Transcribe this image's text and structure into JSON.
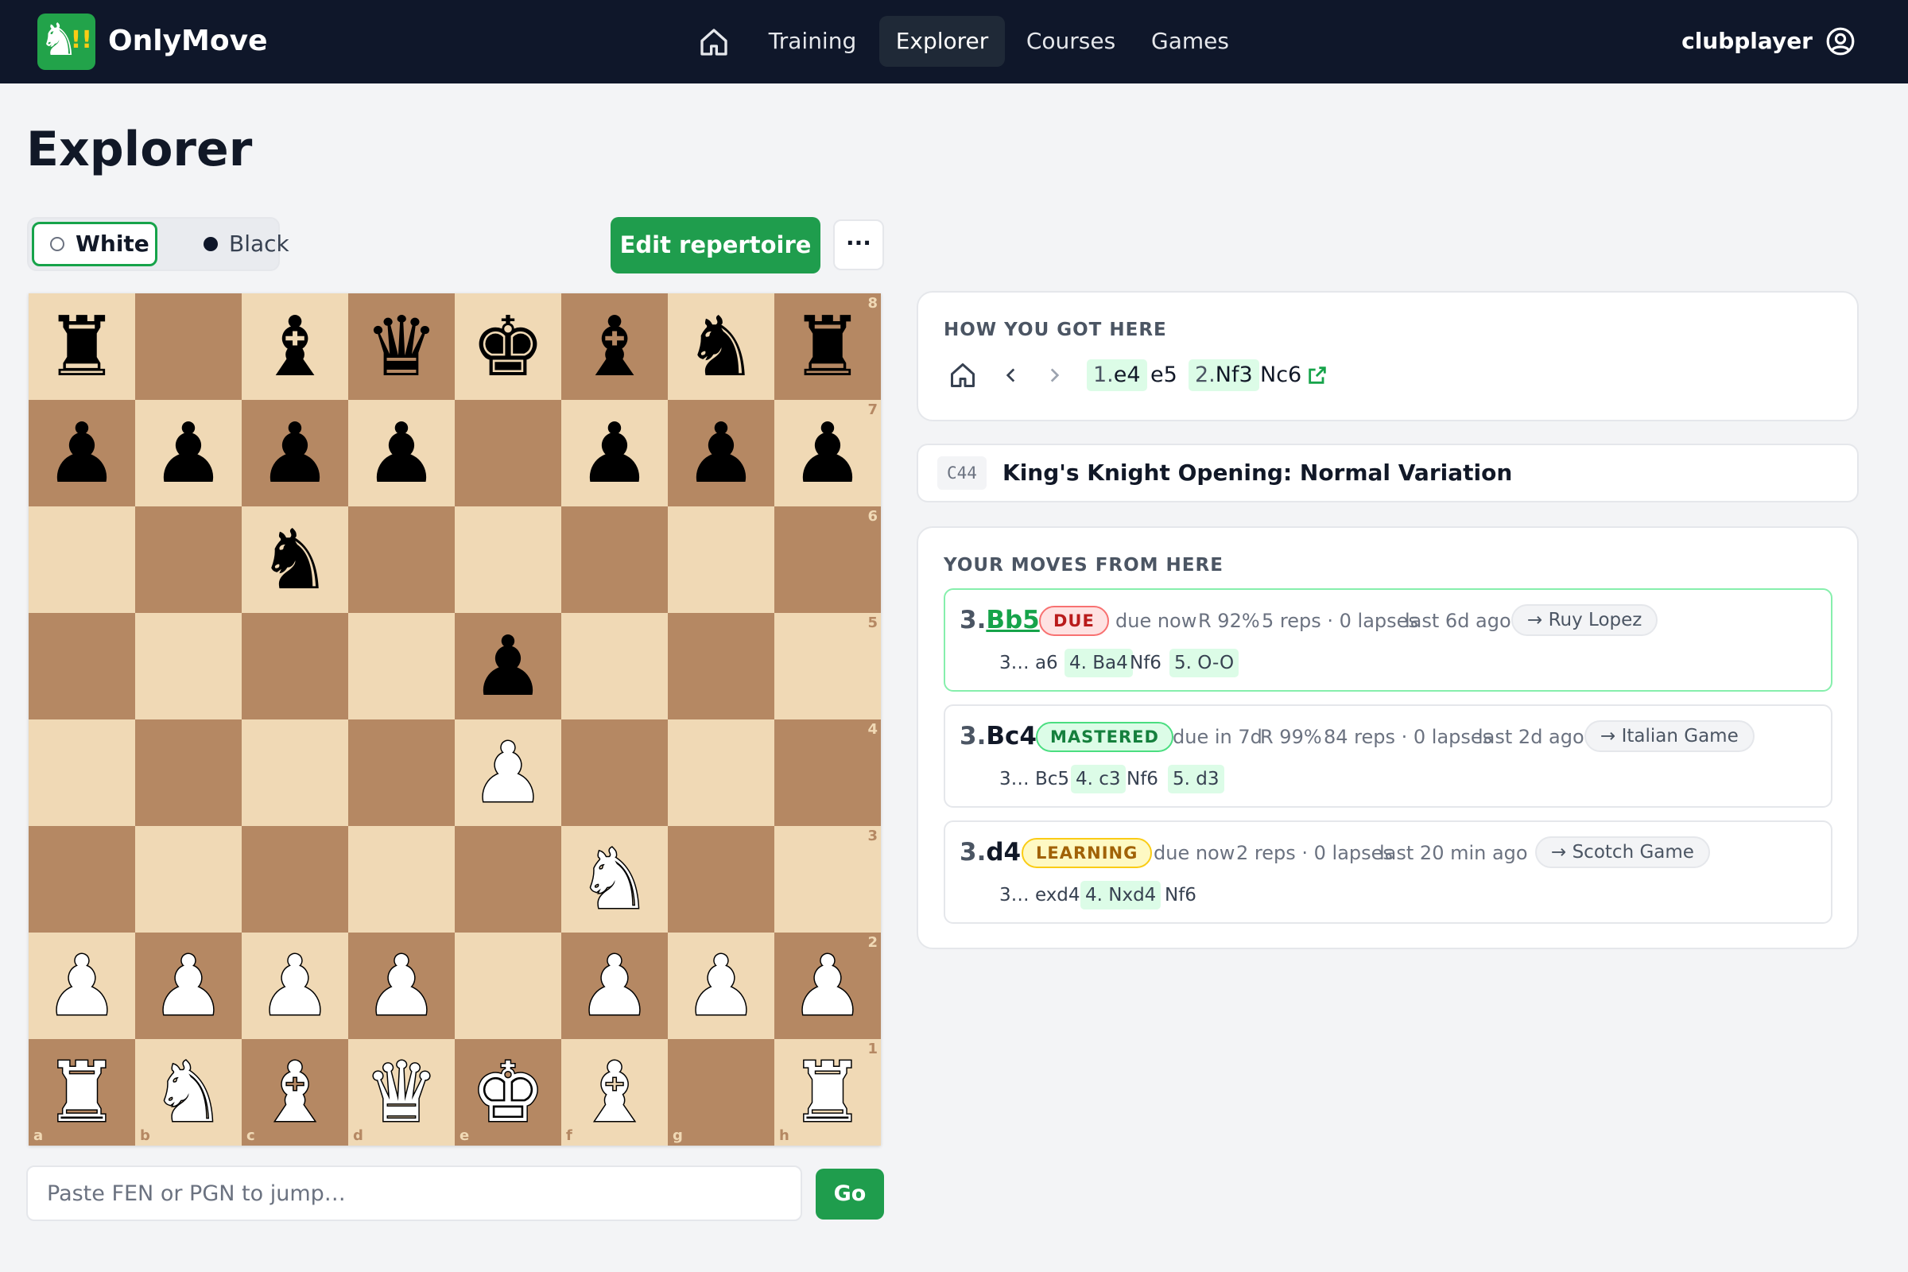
{
  "nav": {
    "brand": "OnlyMove",
    "logo_bang": "!!",
    "items": [
      "Training",
      "Explorer",
      "Courses",
      "Games"
    ],
    "active": "Explorer",
    "user": "clubplayer"
  },
  "page": {
    "title": "Explorer",
    "color_white": "White",
    "color_black": "Black",
    "selected_color": "White",
    "edit_label": "Edit repertoire",
    "more_label": "···",
    "fen_placeholder": "Paste FEN or PGN to jump…",
    "go_label": "Go"
  },
  "board": {
    "rows": [
      [
        "r",
        "",
        "b",
        "q",
        "k",
        "b",
        "n",
        "r"
      ],
      [
        "p",
        "p",
        "p",
        "p",
        "",
        "p",
        "p",
        "p"
      ],
      [
        "",
        "",
        "n",
        "",
        "",
        "",
        "",
        ""
      ],
      [
        "",
        "",
        "",
        "",
        "p",
        "",
        "",
        ""
      ],
      [
        "",
        "",
        "",
        "",
        "P",
        "",
        "",
        ""
      ],
      [
        "",
        "",
        "",
        "",
        "",
        "N",
        "",
        ""
      ],
      [
        "P",
        "P",
        "P",
        "P",
        "",
        "P",
        "P",
        "P"
      ],
      [
        "R",
        "N",
        "B",
        "Q",
        "K",
        "B",
        "",
        "R"
      ]
    ],
    "ranks": [
      "8",
      "7",
      "6",
      "5",
      "4",
      "3",
      "2",
      "1"
    ],
    "files": [
      "a",
      "b",
      "c",
      "d",
      "e",
      "f",
      "g",
      "h"
    ]
  },
  "how": {
    "title": "HOW YOU GOT HERE",
    "moves": [
      {
        "num": "1.",
        "san": "e4",
        "hl": true
      },
      {
        "num": "",
        "san": "e5",
        "hl": false
      },
      {
        "num": "2.",
        "san": "Nf3",
        "hl": true
      },
      {
        "num": "",
        "san": "Nc6",
        "hl": false
      }
    ]
  },
  "opening": {
    "eco": "C44",
    "name": "King's Knight Opening: Normal Variation"
  },
  "moves_section": {
    "title": "YOUR MOVES FROM HERE",
    "rows": [
      {
        "no": "3.",
        "san": "Bb5",
        "badge": "DUE",
        "status": "due",
        "due": "due now",
        "retention": "R 92%",
        "reps": "5 reps · 0 lapses",
        "last": "last 6d ago",
        "opening": "→ Ruy Lopez",
        "cont": [
          "3… a6",
          "4. Ba4",
          "Nf6",
          "5. O-O"
        ]
      },
      {
        "no": "3.",
        "san": "Bc4",
        "badge": "MASTERED",
        "status": "mastered",
        "due": "due in 7d",
        "retention": "R 99%",
        "reps": "84 reps · 0 lapses",
        "last": "last 2d ago",
        "opening": "→ Italian Game",
        "cont": [
          "3… Bc5",
          "4. c3",
          "Nf6",
          "5. d3"
        ]
      },
      {
        "no": "3.",
        "san": "d4",
        "badge": "LEARNING",
        "status": "learning",
        "due": "due now",
        "retention": "",
        "reps": "2 reps · 0 lapses",
        "last": "last 20 min ago",
        "opening": "→ Scotch Game",
        "cont": [
          "3… exd4",
          "4. Nxd4",
          "Nf6"
        ]
      }
    ]
  },
  "colors": {
    "nav_bg": "#0f172a",
    "accent_green": "#1f9d4d",
    "board_light": "#f0d9b5",
    "board_dark": "#b58863"
  },
  "icons": [
    "home-icon",
    "user-circle-icon",
    "chevron-left-icon",
    "chevron-right-icon",
    "external-link-icon",
    "more-icon"
  ]
}
